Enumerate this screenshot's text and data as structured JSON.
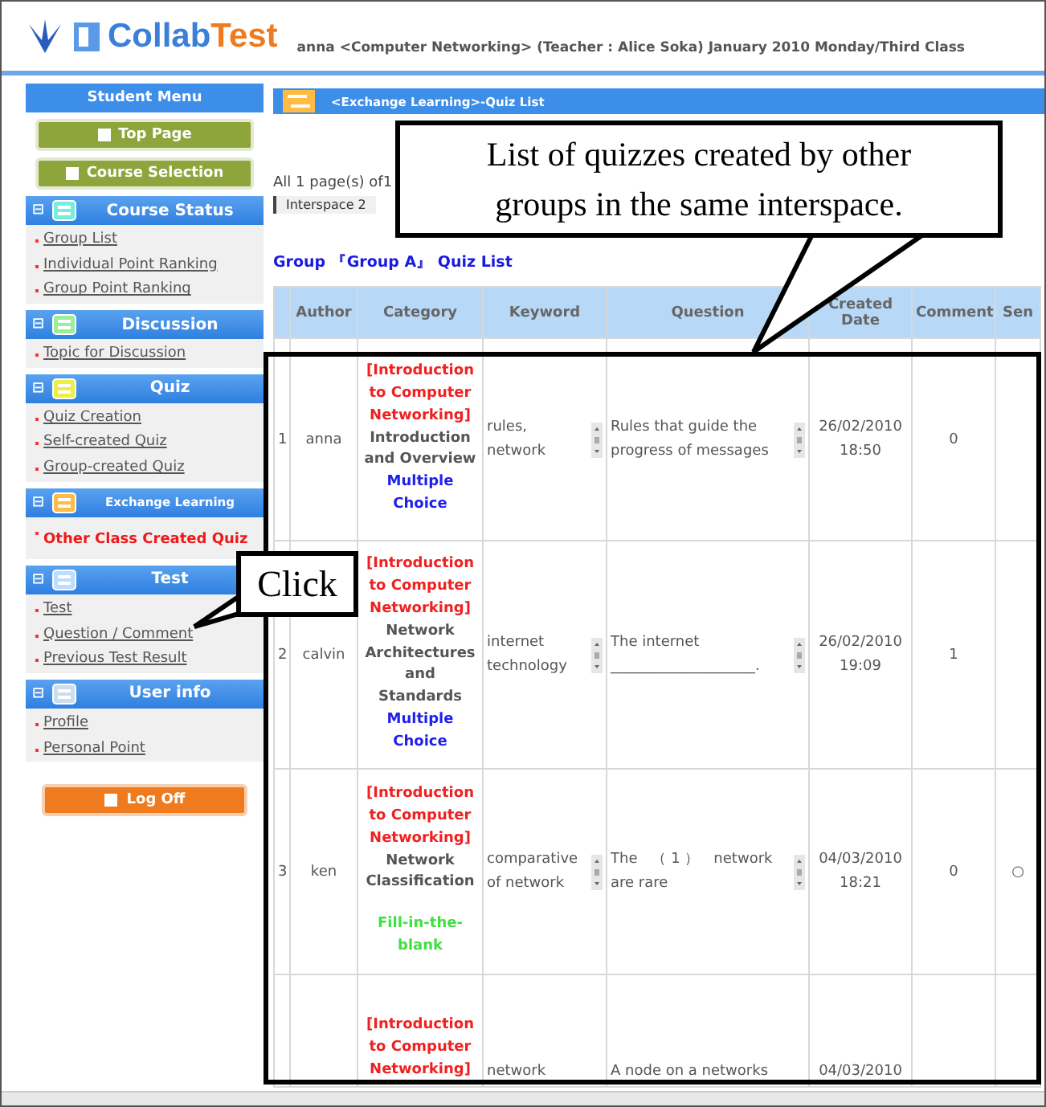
{
  "header": {
    "logo": {
      "part_1": "Collab",
      "part_2": "Test"
    },
    "info": "anna <Computer Networking>  (Teacher : Alice Soka) January 2010 Monday/Third Class"
  },
  "sidebar": {
    "title": "Student Menu",
    "buttons": [
      "Top Page",
      "Course Selection"
    ],
    "sections": [
      {
        "title": "Course Status",
        "toggle": "⊟",
        "items": [
          {
            "label": "Group List",
            "selected": false
          },
          {
            "label": "Individual Point Ranking",
            "selected": false
          },
          {
            "label": "Group Point Ranking",
            "selected": false
          }
        ]
      },
      {
        "title": "Discussion",
        "toggle": "⊟",
        "items": [
          {
            "label": "Topic for Discussion",
            "selected": false
          }
        ]
      },
      {
        "title": "Quiz",
        "toggle": "⊟",
        "items": [
          {
            "label": "Quiz Creation",
            "selected": false
          },
          {
            "label": "Self-created Quiz",
            "selected": false
          },
          {
            "label": "Group-created Quiz",
            "selected": false
          }
        ]
      },
      {
        "title": "Exchange Learning",
        "toggle": "⊟",
        "items": [
          {
            "label": "Other Class Created Quiz",
            "selected": true
          }
        ]
      },
      {
        "title": "Test",
        "toggle": "⊟",
        "items": [
          {
            "label": "Test",
            "selected": false
          },
          {
            "label": "Question / Comment",
            "selected": false
          },
          {
            "label": "Previous Test Result",
            "selected": false
          }
        ]
      },
      {
        "title": "User info",
        "toggle": "⊟",
        "items": [
          {
            "label": "Profile",
            "selected": false
          },
          {
            "label": "Personal Point",
            "selected": false
          }
        ]
      }
    ],
    "logoff": "Log Off"
  },
  "main": {
    "title": "<Exchange Learning>-Quiz List",
    "pages": "All 1 page(s) of1",
    "tab": "Interspace 2",
    "group_title": "Group 『Group A』 Quiz List",
    "table": {
      "columns": [
        "",
        "Author",
        "Category",
        "Keyword",
        "Question",
        "Created Date",
        "Comment",
        "Sen"
      ],
      "rows": [
        {
          "no": "1",
          "author": "anna",
          "topic": "[Introduction to Computer Networking]",
          "subtopic": "Introduction and Overview",
          "type": "Multiple Choice",
          "kind": "choice",
          "keyword": "rules, network",
          "question": "Rules that guide the progress of messages",
          "date": "26/02/2010 18:50",
          "comment": "0"
        },
        {
          "no": "2",
          "author": "calvin",
          "topic": "[Introduction to Computer Networking]",
          "subtopic": "Network Architectures and Standards",
          "type": "Multiple Choice",
          "kind": "choice",
          "keyword": "internet technology",
          "question": "The internet ____________________.",
          "date": "26/02/2010 19:09",
          "comment": "1"
        },
        {
          "no": "3",
          "author": "ken",
          "topic": "[Introduction to Computer Networking]",
          "subtopic": "Network Classification",
          "type": "Fill-in-the-blank",
          "kind": "blank",
          "keyword": "comparative of network",
          "question": "The　（ 1 ）　network are rare",
          "date": "04/03/2010 18:21",
          "comment": "0",
          "send": "○"
        },
        {
          "topic": "[Introduction to Computer Networking]",
          "keyword": "network",
          "question": "A node on a networks",
          "date": "04/03/2010"
        }
      ]
    }
  },
  "callouts": [
    {
      "kind": "list",
      "text": "List of quizzes created by other groups in the same interspace."
    },
    {
      "kind": "click",
      "text": "Click"
    }
  ]
}
